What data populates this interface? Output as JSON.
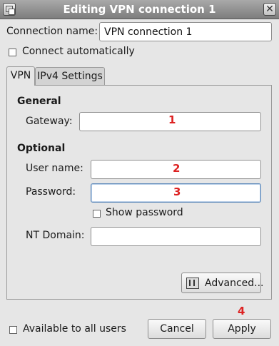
{
  "window": {
    "title": "Editing VPN connection 1",
    "close_glyph": "✕"
  },
  "connection": {
    "name_label": "Connection name:",
    "name_value": "VPN connection 1",
    "auto_connect_label": "Connect automatically"
  },
  "tabs": [
    {
      "label": "VPN",
      "active": true
    },
    {
      "label": "IPv4 Settings",
      "active": false
    }
  ],
  "vpn": {
    "general_heading": "General",
    "gateway_label": "Gateway:",
    "gateway_value": "",
    "optional_heading": "Optional",
    "username_label": "User name:",
    "username_value": "",
    "password_label": "Password:",
    "password_value": "",
    "show_password_label": "Show password",
    "nt_domain_label": "NT Domain:",
    "nt_domain_value": "",
    "advanced_button": "Advanced..."
  },
  "footer": {
    "all_users_label": "Available to all users",
    "cancel_button": "Cancel",
    "apply_button": "Apply"
  },
  "annotations": {
    "marker_1": "1",
    "marker_2": "2",
    "marker_3": "3",
    "marker_4": "4",
    "color": "#d22222"
  },
  "icons": [
    "window-menu-icon",
    "close-icon",
    "advanced-settings-icon"
  ]
}
